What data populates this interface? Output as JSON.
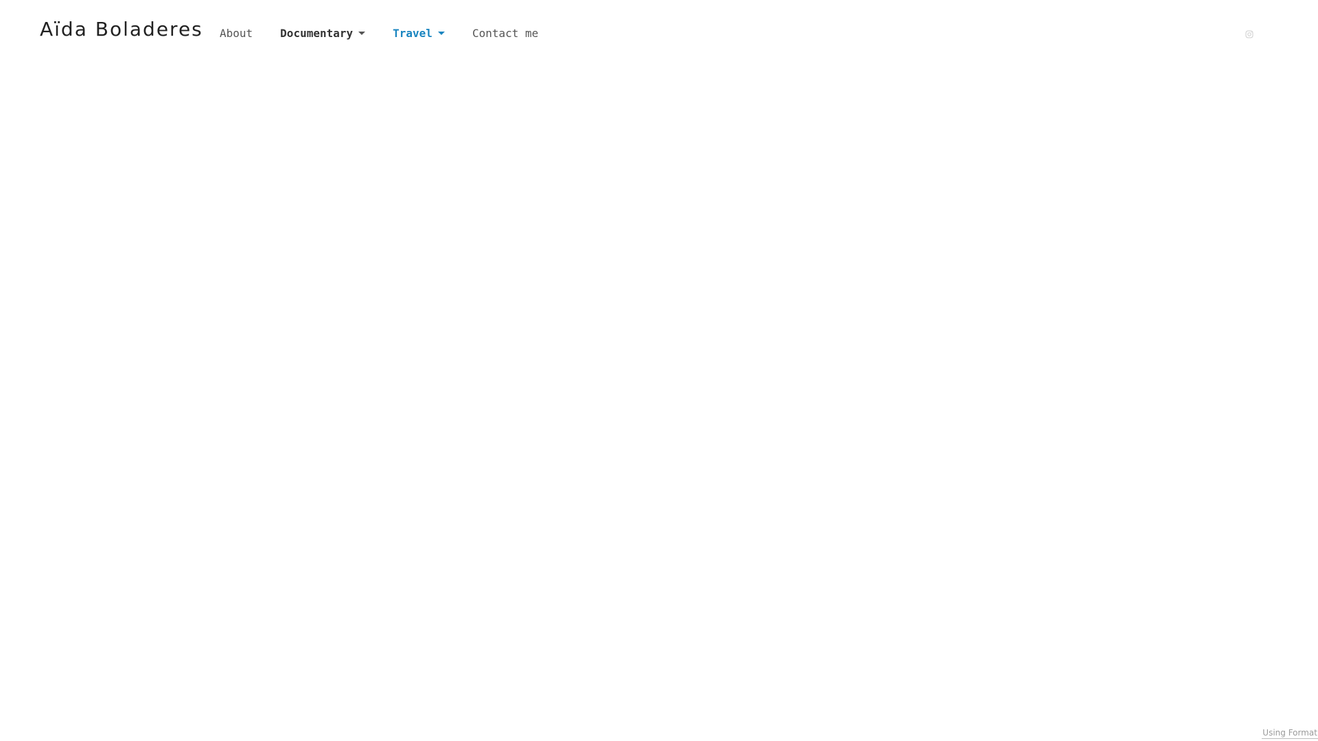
{
  "site": {
    "title": "Aïda Boladeres"
  },
  "nav": {
    "items": [
      {
        "label": "About"
      },
      {
        "label": "Documentary"
      },
      {
        "label": "Travel"
      },
      {
        "label": "Contact me"
      }
    ],
    "active_color": "#1a85c0"
  },
  "social": {
    "icon": "instagram-icon"
  },
  "footer": {
    "badge_label": "Using Format"
  }
}
